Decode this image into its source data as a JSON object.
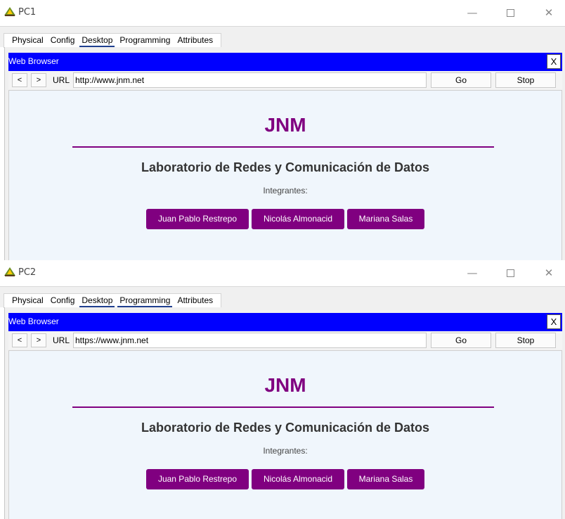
{
  "windows": [
    {
      "title": "PC1",
      "tabs": [
        "Physical",
        "Config",
        "Desktop",
        "Programming",
        "Attributes"
      ],
      "active_tab": "Desktop",
      "browser": {
        "title": "Web Browser",
        "close_label": "X",
        "back_label": "<",
        "forward_label": ">",
        "url_label": "URL",
        "url_value": "http://www.jnm.net",
        "go_label": "Go",
        "stop_label": "Stop",
        "page": {
          "heading": "JNM",
          "subtitle": "Laboratorio de Redes y Comunicación de Datos",
          "members_label": "Integrantes:",
          "members": [
            "Juan Pablo Restrepo",
            "Nicolás Almonacid",
            "Mariana Salas"
          ]
        }
      }
    },
    {
      "title": "PC2",
      "tabs": [
        "Physical",
        "Config",
        "Desktop",
        "Programming",
        "Attributes"
      ],
      "active_tab": "Desktop",
      "browser": {
        "title": "Web Browser",
        "close_label": "X",
        "back_label": "<",
        "forward_label": ">",
        "url_label": "URL",
        "url_value": "https://www.jnm.net",
        "go_label": "Go",
        "stop_label": "Stop",
        "page": {
          "heading": "JNM",
          "subtitle": "Laboratorio de Redes y Comunicación de Datos",
          "members_label": "Integrantes:",
          "members": [
            "Juan Pablo Restrepo",
            "Nicolás Almonacid",
            "Mariana Salas"
          ]
        }
      }
    }
  ],
  "window_controls": {
    "minimize": "—",
    "close": "✕"
  },
  "colors": {
    "browser_header": "#0000ff",
    "site_accent": "#800080",
    "page_background": "#f0f6fc"
  },
  "icons": {
    "app_icon": "packet-tracer-pc-icon"
  }
}
